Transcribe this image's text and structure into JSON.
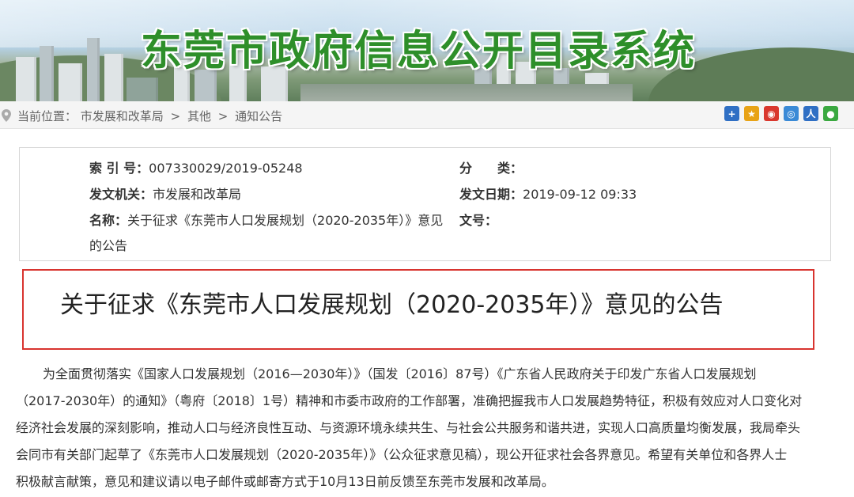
{
  "banner": {
    "title": "东莞市政府信息公开目录系统"
  },
  "breadcrumb": {
    "prefix": "当前位置：",
    "items": [
      "市发展和改革局",
      "其他",
      "通知公告"
    ],
    "separator": ">"
  },
  "share_icons": [
    {
      "name": "plus-share-icon",
      "glyph": "+",
      "color": "#2f6fc4"
    },
    {
      "name": "qzone-share-icon",
      "glyph": "★",
      "color": "#e8a317"
    },
    {
      "name": "weibo-share-icon",
      "glyph": "◉",
      "color": "#d9382e"
    },
    {
      "name": "tencent-share-icon",
      "glyph": "◎",
      "color": "#3a8ad6"
    },
    {
      "name": "renren-share-icon",
      "glyph": "人",
      "color": "#2f6fc4"
    },
    {
      "name": "wechat-share-icon",
      "glyph": "●",
      "color": "#3aa840"
    }
  ],
  "meta": {
    "index_label": "索 引 号：",
    "index_value": "007330029/2019-05248",
    "category_label": "分　　类：",
    "category_value": "",
    "issuer_label": "发文机关：",
    "issuer_value": "市发展和改革局",
    "date_label": "发文日期：",
    "date_value": "2019-09-12 09:33",
    "name_label": "名称：",
    "name_value_line1": "关于征求《东莞市人口发展规划（2020-2035年）》意见",
    "name_value_line2": "的公告",
    "docno_label": "文号：",
    "docno_value": ""
  },
  "document": {
    "title": "关于征求《东莞市人口发展规划（2020-2035年）》意见的公告",
    "body_lines": [
      "为全面贯彻落实《国家人口发展规划（2016—2030年）》（国发〔2016〕87号）《广东省人民政府关于印发广东省人口发展规划",
      "（2017-2030年）的通知》（粤府〔2018〕1号）精神和市委市政府的工作部署，准确把握我市人口发展趋势特征，积极有效应对人口变化对",
      "经济社会发展的深刻影响，推动人口与经济良性互动、与资源环境永续共生、与社会公共服务和谐共进，实现人口高质量均衡发展，我局牵头",
      "会同市有关部门起草了《东莞市人口发展规划（2020-2035年）》（公众征求意见稿），现公开征求社会各界意见。希望有关单位和各界人士",
      "积极献言献策，意见和建议请以电子邮件或邮寄方式于10月13日前反馈至东莞市发展和改革局。"
    ]
  },
  "colors": {
    "banner_title": "#2e8f2a",
    "title_border": "#d8342f",
    "text": "#333333"
  }
}
